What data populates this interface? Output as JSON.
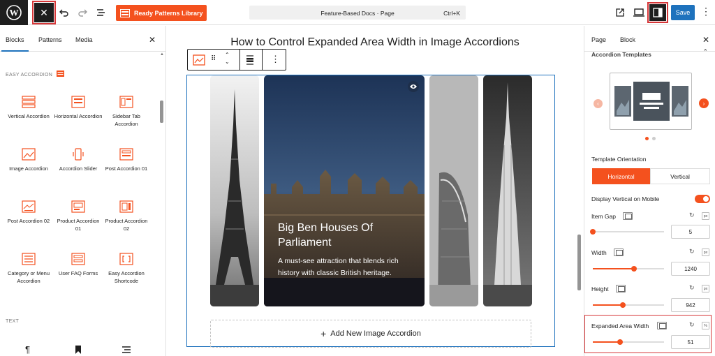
{
  "toolbar": {
    "ready_patterns_label": "Ready Patterns Library",
    "command_title": "Feature-Based Docs · Page",
    "command_shortcut": "Ctrl+K",
    "save_label": "Save"
  },
  "left_panel": {
    "tabs": [
      "Blocks",
      "Patterns",
      "Media"
    ],
    "section_easy": "EASY ACCORDION",
    "section_text": "TEXT",
    "blocks": [
      {
        "label": "Vertical Accordion",
        "icon": "vertical-accordion-icon"
      },
      {
        "label": "Horizontal Accordion",
        "icon": "horizontal-accordion-icon"
      },
      {
        "label": "Sidebar Tab Accordion",
        "icon": "sidebar-tab-accordion-icon"
      },
      {
        "label": "Image Accordion",
        "icon": "image-accordion-icon"
      },
      {
        "label": "Accordion Slider",
        "icon": "accordion-slider-icon"
      },
      {
        "label": "Post Accordion 01",
        "icon": "post-accordion-icon"
      },
      {
        "label": "Post Accordion 02",
        "icon": "post-accordion-icon"
      },
      {
        "label": "Product Accordion 01",
        "icon": "product-accordion-icon"
      },
      {
        "label": "Product Accordion 02",
        "icon": "product-accordion-icon"
      },
      {
        "label": "Category or Menu Accordion",
        "icon": "category-accordion-icon"
      },
      {
        "label": "User FAQ Forms",
        "icon": "faq-form-icon"
      },
      {
        "label": "Easy Accordion Shortcode",
        "icon": "shortcode-icon"
      }
    ]
  },
  "canvas": {
    "title": "How to Control Expanded Area Width in Image Accordions",
    "featured_title": "Big Ben Houses Of Parliament",
    "featured_desc": "A must-see attraction that blends rich history with classic British heritage.",
    "add_new_label": "Add New Image Accordion"
  },
  "right_panel": {
    "tabs": [
      "Page",
      "Block"
    ],
    "section_title": "Accordion Templates",
    "orientation_label": "Template Orientation",
    "orientation_options": [
      "Horizontal",
      "Vertical"
    ],
    "mobile_label": "Display Vertical on Mobile",
    "settings": [
      {
        "label": "Item Gap",
        "value": "5",
        "unit": "px",
        "level": 0.0
      },
      {
        "label": "Width",
        "value": "1240",
        "unit": "px",
        "level": 0.58
      },
      {
        "label": "Height",
        "value": "942",
        "unit": "px",
        "level": 0.42
      },
      {
        "label": "Expanded Area Width",
        "value": "51",
        "unit": "%",
        "level": 0.38
      }
    ]
  },
  "colors": {
    "accent": "#f4511e",
    "primary": "#1e72bd",
    "highlight": "#d63638"
  }
}
